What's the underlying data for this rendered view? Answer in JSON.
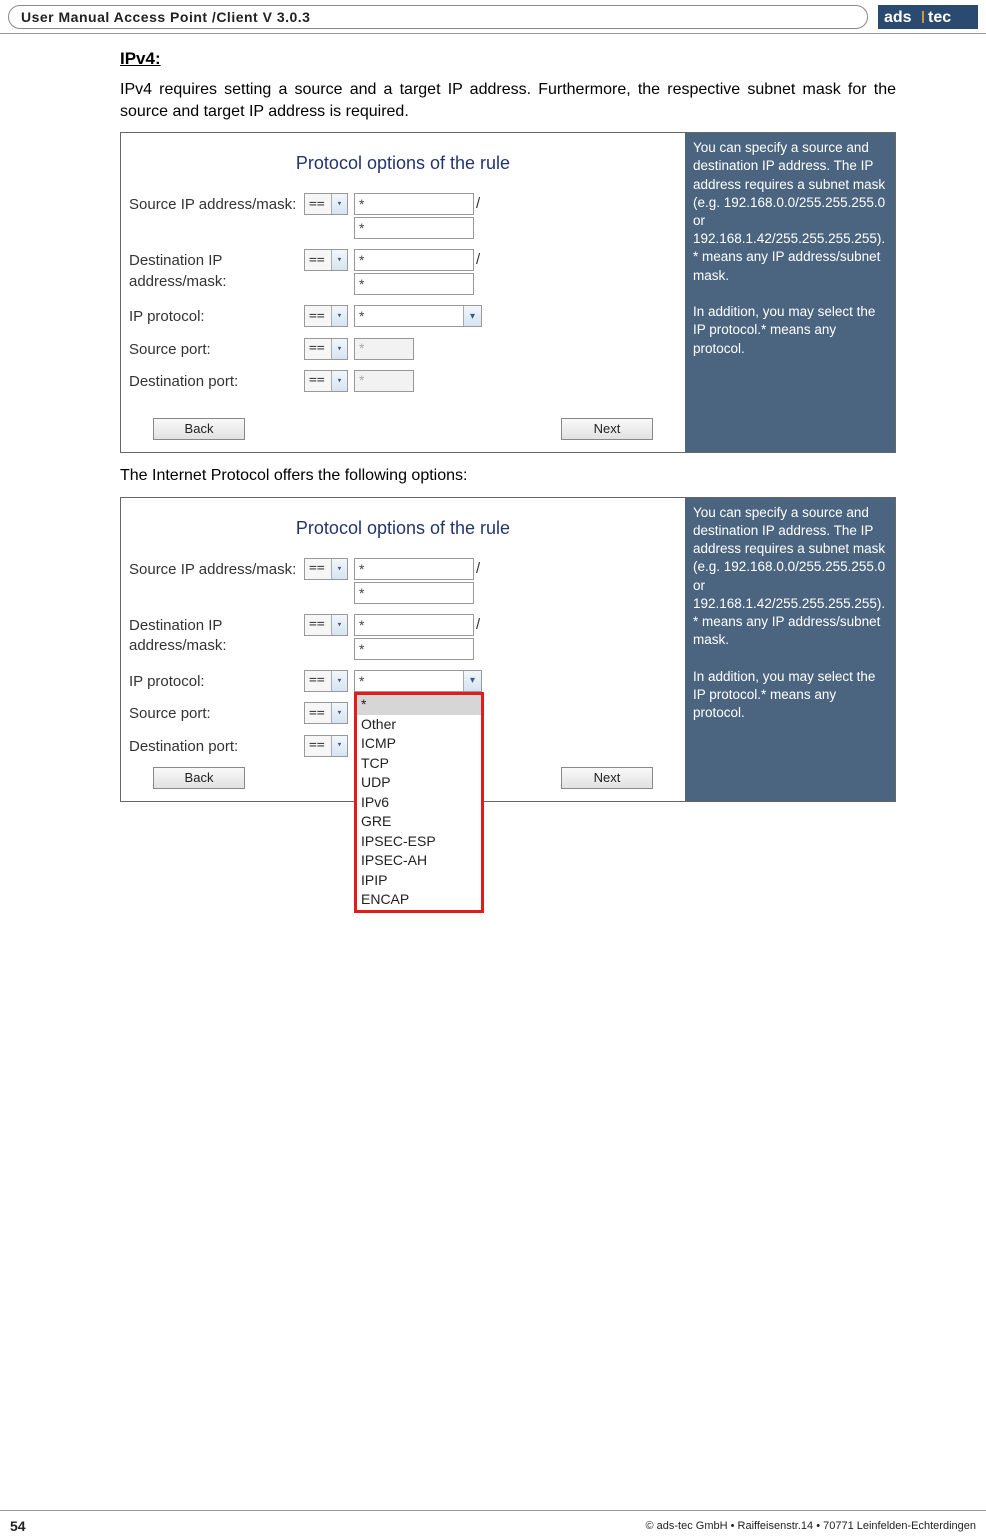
{
  "header": {
    "title": "User Manual Access Point /Client V 3.0.3",
    "logo_text": "ads tec"
  },
  "section_heading": "IPv4:",
  "intro_text": "IPv4 requires setting a source and a target IP address. Furthermore, the respective subnet mask for the source and target IP address is required.",
  "panel1": {
    "title": "Protocol options of the rule",
    "rows": {
      "src_label": "Source IP address/mask:",
      "dst_label": "Destination IP address/mask:",
      "proto_label": "IP protocol:",
      "sport_label": "Source port:",
      "dport_label": "Destination port:",
      "op": "==",
      "star": "*",
      "proto_val": "*"
    },
    "buttons": {
      "back": "Back",
      "next": "Next"
    },
    "help": "You can specify a source and destination IP address. The IP address requires a subnet mask (e.g. 192.168.0.0/255.255.255.0 or 192.168.1.42/255.255.255.255).\n* means any IP address/subnet mask.\n\nIn addition, you may select the IP protocol.* means any protocol."
  },
  "mid_text": "The Internet Protocol offers the following options:",
  "panel2": {
    "title": "Protocol options of the rule",
    "rows": {
      "src_label": "Source IP address/mask:",
      "dst_label": "Destination IP address/mask:",
      "proto_label": "IP protocol:",
      "sport_label": "Source port:",
      "dport_label": "Destination port:",
      "op": "==",
      "star": "*",
      "proto_val": "*"
    },
    "buttons": {
      "back": "Back",
      "next": "Next"
    },
    "help": "You can specify a source and destination IP address. The IP address requires a subnet mask (e.g. 192.168.0.0/255.255.255.0 or 192.168.1.42/255.255.255.255).\n* means any IP address/subnet mask.\n\nIn addition, you may select the IP protocol.* means any protocol.",
    "dropdown": [
      "*",
      "Other",
      "ICMP",
      "TCP",
      "UDP",
      "IPv6",
      "GRE",
      "IPSEC-ESP",
      "IPSEC-AH",
      "IPIP",
      "ENCAP"
    ]
  },
  "footer": {
    "page": "54",
    "copyright": "© ads-tec GmbH • Raiffeisenstr.14 • 70771 Leinfelden-Echterdingen"
  }
}
